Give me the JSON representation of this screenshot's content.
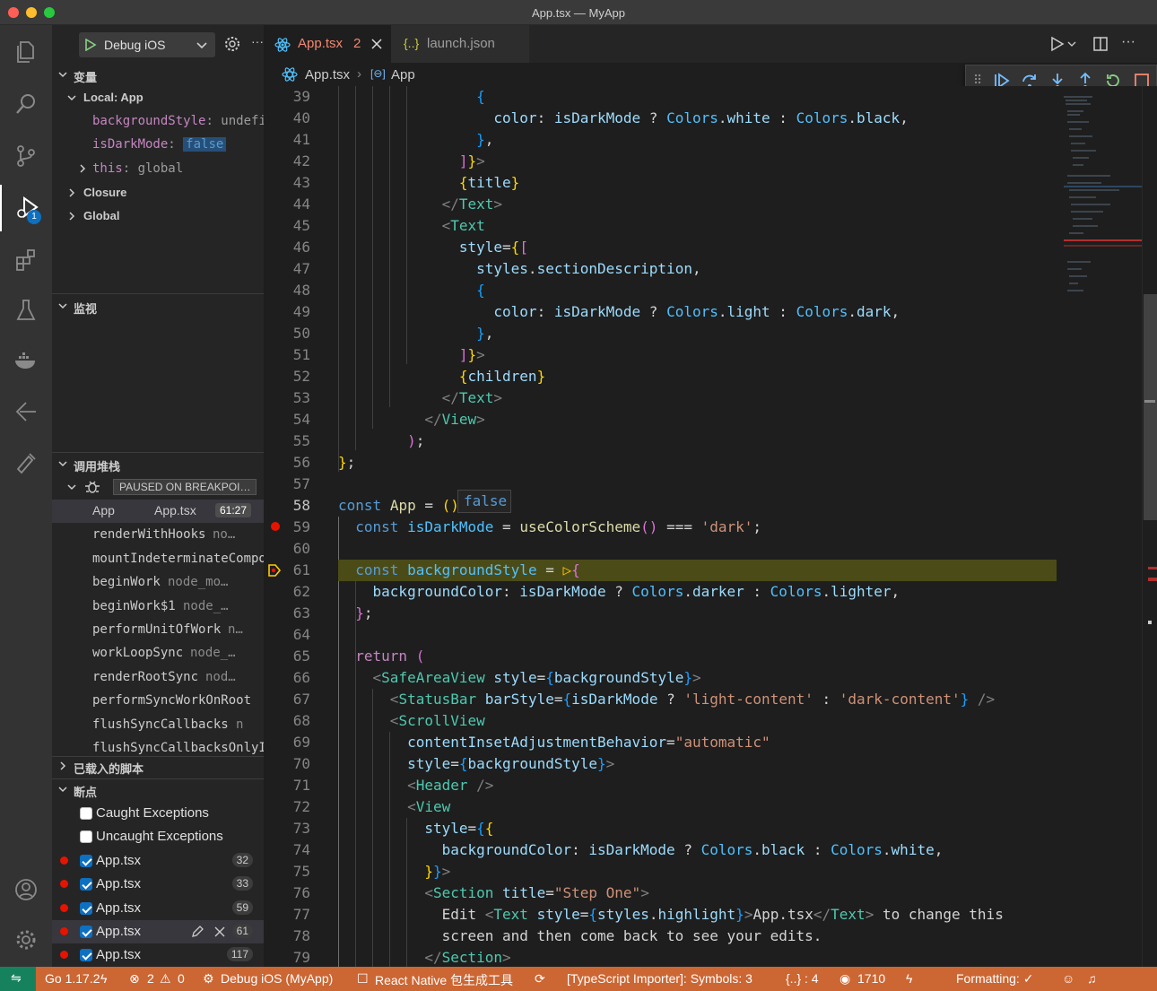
{
  "window": {
    "title": "App.tsx — MyApp"
  },
  "activity_bar": {
    "items": [
      "explorer-icon",
      "search-icon",
      "source-control-icon",
      "run-debug-icon",
      "extensions-icon",
      "testing-icon",
      "docker-icon",
      "git-graph-icon",
      "remote-icon"
    ],
    "debug_badge": "1",
    "bottom": [
      "account-icon",
      "manage-gear-icon"
    ]
  },
  "debug_toolbar": {
    "config": "Debug iOS",
    "more": "···"
  },
  "variables": {
    "title": "变量",
    "local_title": "Local: App",
    "items": [
      {
        "name": "backgroundStyle",
        "value": "undefi…"
      },
      {
        "name": "isDarkMode",
        "value": "false"
      },
      {
        "name": "this",
        "value": "global"
      }
    ],
    "closure": "Closure",
    "global": "Global"
  },
  "watch": {
    "title": "监视"
  },
  "call_stack": {
    "title": "调用堆栈",
    "paused": "PAUSED ON BREAKPOI…",
    "frames": [
      {
        "name": "App",
        "file": "App.tsx",
        "line": "61:27"
      },
      {
        "name": "renderWithHooks",
        "file": "no…"
      },
      {
        "name": "mountIndeterminateCompon",
        "file": ""
      },
      {
        "name": "beginWork",
        "file": "node_mo…"
      },
      {
        "name": "beginWork$1",
        "file": "node_…"
      },
      {
        "name": "performUnitOfWork",
        "file": "n…"
      },
      {
        "name": "workLoopSync",
        "file": "node_…"
      },
      {
        "name": "renderRootSync",
        "file": "nod…"
      },
      {
        "name": "performSyncWorkOnRoot",
        "file": ""
      },
      {
        "name": "flushSyncCallbacks",
        "file": "n"
      },
      {
        "name": "flushSyncCallbacksOnlyIn",
        "file": ""
      }
    ]
  },
  "loaded_scripts": {
    "title": "已载入的脚本"
  },
  "breakpoints": {
    "title": "断点",
    "exceptions": [
      {
        "label": "Caught Exceptions",
        "checked": false
      },
      {
        "label": "Uncaught Exceptions",
        "checked": false
      }
    ],
    "items": [
      {
        "file": "App.tsx",
        "line": "32"
      },
      {
        "file": "App.tsx",
        "line": "33"
      },
      {
        "file": "App.tsx",
        "line": "59"
      },
      {
        "file": "App.tsx",
        "line": "61"
      },
      {
        "file": "App.tsx",
        "line": "117"
      }
    ]
  },
  "tabs": [
    {
      "label": "App.tsx",
      "badge": "2",
      "active": true
    },
    {
      "label": "launch.json",
      "active": false
    }
  ],
  "breadcrumb": {
    "file": "App.tsx",
    "symbol": "App"
  },
  "hover": {
    "value": "false"
  },
  "status_bar": {
    "go": "Go 1.17.2",
    "errors": "2",
    "warnings": "0",
    "debug": "Debug iOS (MyApp)",
    "rn": "React Native 包生成工具",
    "ts": "[TypeScript Importer]: Symbols: 3",
    "json": "{..} : 4",
    "count": "1710",
    "formatting": "Formatting: ✓"
  },
  "colors": {
    "status_bar": "#cc6633",
    "accent": "#0e70c0",
    "breakpoint": "#e51400"
  }
}
